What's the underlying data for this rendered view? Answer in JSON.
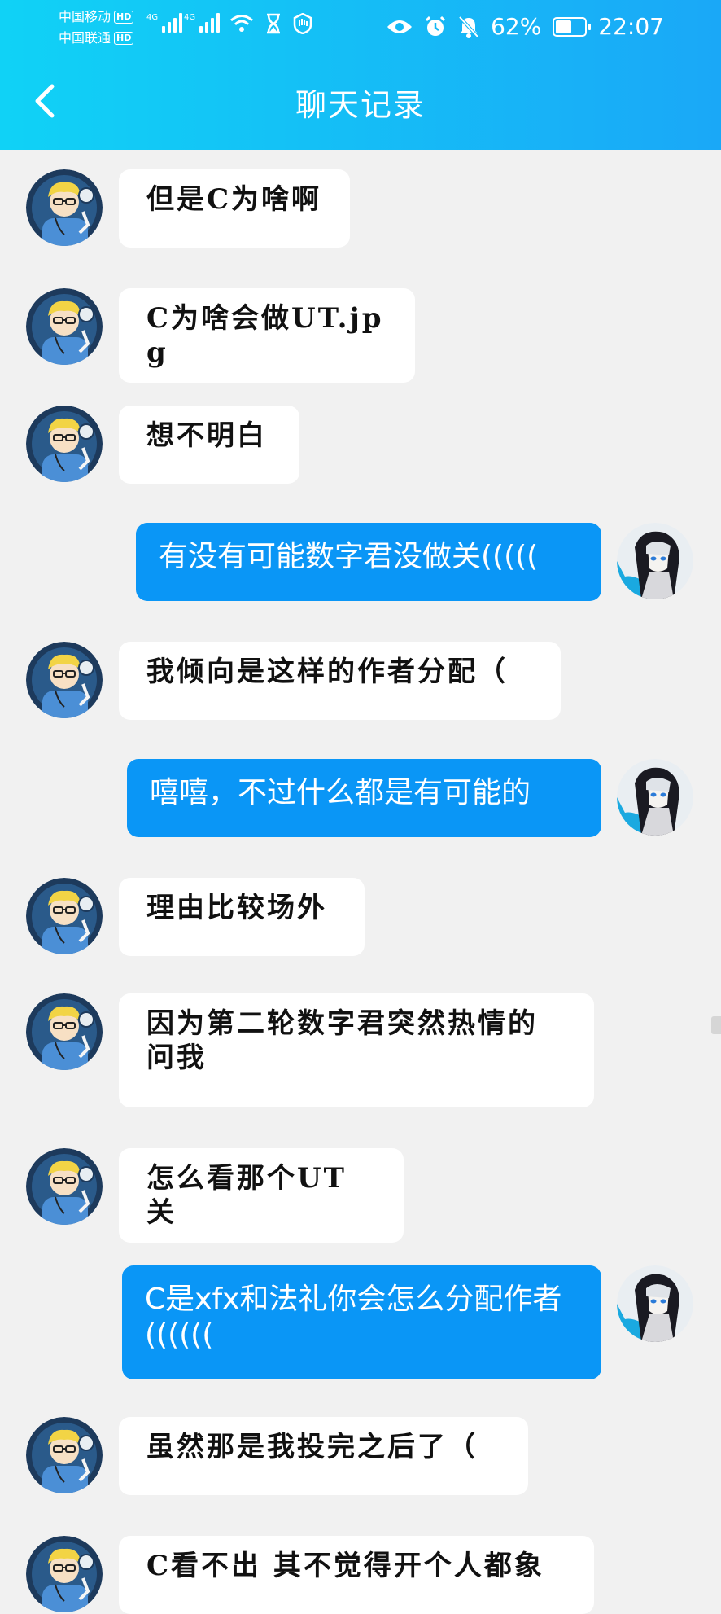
{
  "status": {
    "carrier1": "中国移动",
    "carrier2": "中国联通",
    "hd": "HD",
    "net1": "4G",
    "net2": "4G",
    "battery_pct": "62%",
    "battery_level": 0.62,
    "time": "22:07"
  },
  "header": {
    "title": "聊天记录",
    "back_icon": "chevron-left-icon"
  },
  "colors": {
    "header_start": "#10d2f6",
    "header_end": "#1aa8f7",
    "outgoing": "#0a96f6",
    "incoming": "#ffffff",
    "background": "#f1f1f1"
  },
  "messages": [
    {
      "side": "in",
      "text": "但是C为啥啊"
    },
    {
      "side": "in",
      "text": "C为啥会做UT.jpg"
    },
    {
      "side": "in",
      "text": "想不明白"
    },
    {
      "side": "out",
      "text": "有没有可能数字君没做关((((("
    },
    {
      "side": "in",
      "text": "我倾向是这样的作者分配（"
    },
    {
      "side": "out",
      "text": "嘻嘻，不过什么都是有可能的"
    },
    {
      "side": "in",
      "text": "理由比较场外"
    },
    {
      "side": "in",
      "text": "因为第二轮数字君突然热情的问我"
    },
    {
      "side": "in",
      "text": "怎么看那个UT关"
    },
    {
      "side": "out",
      "text": "C是xfx和法礼你会怎么分配作者(((((("
    },
    {
      "side": "in",
      "text": "虽然那是我投完之后了（"
    },
    {
      "side": "in",
      "text": "C看不出 其不觉得开个人都象"
    }
  ]
}
